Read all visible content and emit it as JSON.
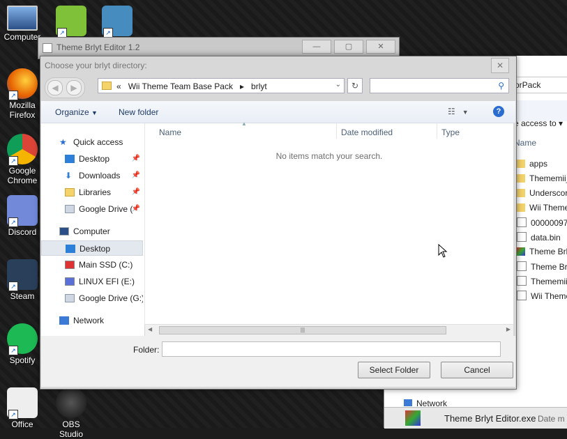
{
  "desktop": {
    "icons": [
      {
        "id": "computer",
        "label": "Computer"
      },
      {
        "id": "notepad",
        "label": ""
      },
      {
        "id": "godot",
        "label": ""
      },
      {
        "id": "firefox",
        "label": "Mozilla Firefox"
      },
      {
        "id": "chrome",
        "label": "Google Chrome"
      },
      {
        "id": "discord",
        "label": "Discord"
      },
      {
        "id": "steam",
        "label": "Steam"
      },
      {
        "id": "spotify",
        "label": "Spotify"
      },
      {
        "id": "office",
        "label": "Office"
      },
      {
        "id": "obs",
        "label": "OBS Studio"
      }
    ]
  },
  "bg_window": {
    "address_tail": "orPack",
    "access_label": "e access to",
    "col_name": "Name",
    "rows": [
      "apps",
      "Thememii_",
      "Underscor",
      "Wii Theme",
      "00000097.a",
      "data.bin",
      "Theme Brly",
      "Theme Brly",
      "Thememii_",
      "Wii Theme"
    ],
    "network_label": "Network",
    "taskbar_item": "Theme Brlyt Editor.exe",
    "taskbar_item_tail": "Date m"
  },
  "back_window": {
    "title": "Theme Brlyt Editor 1.2"
  },
  "dialog": {
    "title": "Choose your brlyt directory:",
    "close_glyph": "✕",
    "path": {
      "prefix": "«",
      "segments": [
        "Wii Theme Team Base Pack",
        "brlyt"
      ],
      "separator": "▸"
    },
    "search_placeholder": "",
    "toolbar": {
      "organize": "Organize",
      "new_folder": "New folder",
      "help": "?"
    },
    "nav": {
      "quick_access": "Quick access",
      "items": [
        {
          "label": "Desktop",
          "pinned": true
        },
        {
          "label": "Downloads",
          "pinned": true
        },
        {
          "label": "Libraries",
          "pinned": true
        },
        {
          "label": "Google Drive (",
          "pinned": true
        }
      ],
      "computer": "Computer",
      "computer_items": [
        {
          "label": "Desktop",
          "selected": true
        },
        {
          "label": "Main SSD (C:)"
        },
        {
          "label": "LINUX EFI (E:)"
        },
        {
          "label": "Google Drive (G:)"
        }
      ],
      "network": "Network"
    },
    "columns": {
      "name": "Name",
      "date_modified": "Date modified",
      "type": "Type"
    },
    "empty_message": "No items match your search.",
    "folder_label": "Folder:",
    "folder_value": "",
    "select_button": "Select Folder",
    "cancel_button": "Cancel"
  },
  "colors": {
    "accent": "#2a6ccf",
    "folder": "#f4d36b"
  }
}
